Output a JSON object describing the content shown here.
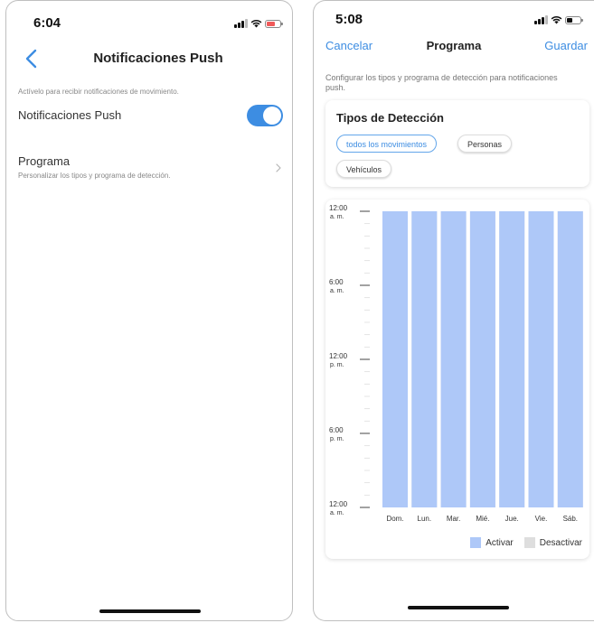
{
  "left_screen": {
    "status_time": "6:04",
    "header": {
      "title": "Notificaciones Push",
      "back_icon": "chevron-left-icon"
    },
    "caption": "Actívelo para recibir notificaciones de movimiento.",
    "push_row": {
      "label": "Notificaciones Push",
      "toggle_on": true
    },
    "schedule_row": {
      "title": "Programa",
      "subtitle": "Personalizar los tipos y programa de detección.",
      "chevron_icon": "chevron-right-icon"
    }
  },
  "right_screen": {
    "status_time": "5:08",
    "header": {
      "cancel": "Cancelar",
      "title": "Programa",
      "save": "Guardar"
    },
    "description": "Configurar los tipos y programa de detección para notificaciones push.",
    "detection_types": {
      "title": "Tipos de Detección",
      "chips": [
        {
          "label": "todos los movimientos",
          "selected": true
        },
        {
          "label": "Personas",
          "selected": false
        },
        {
          "label": "Vehículos",
          "selected": false
        }
      ]
    },
    "schedule": {
      "time_labels": [
        [
          "12:00",
          "a. m."
        ],
        [
          "6:00",
          "a. m."
        ],
        [
          "12:00",
          "p. m."
        ],
        [
          "6:00",
          "p. m."
        ],
        [
          "12:00",
          "a. m."
        ]
      ],
      "days": [
        "Dom.",
        "Lun.",
        "Mar.",
        "Mié.",
        "Jue.",
        "Vie.",
        "Sáb."
      ],
      "active_hours": [
        [
          0,
          24
        ],
        [
          0,
          24
        ],
        [
          0,
          24
        ],
        [
          0,
          24
        ],
        [
          0,
          24
        ],
        [
          0,
          24
        ],
        [
          0,
          24
        ]
      ],
      "legend": {
        "active": "Activar",
        "inactive": "Desactivar"
      }
    }
  },
  "colors": {
    "accent": "#3d8de2",
    "active": "#aec8f8",
    "inactive": "#dedede"
  }
}
